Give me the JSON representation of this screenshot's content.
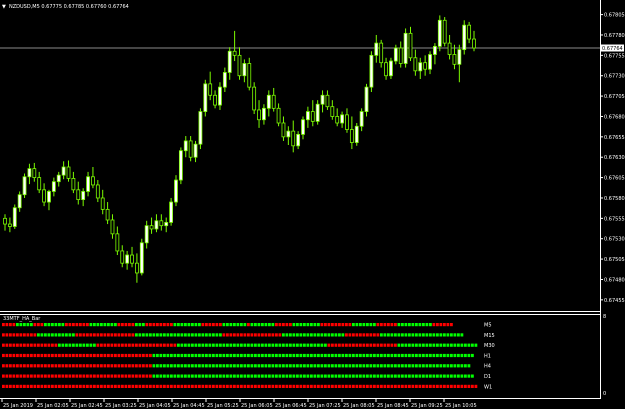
{
  "main_chart": {
    "symbol_header": "NZDUSD,M5  0.67775 0.67785 0.67760 0.67764",
    "price_labels": [
      "0.67805",
      "0.67780",
      "0.67755",
      "0.67730",
      "0.67705",
      "0.67680",
      "0.67655",
      "0.67630",
      "0.67605",
      "0.67580",
      "0.67555",
      "0.67530",
      "0.67505",
      "0.67480",
      "0.67455"
    ],
    "current_price": "0.67764",
    "current_price_value": 0.67764,
    "y_range": [
      0.67445,
      0.67818
    ],
    "candle_color": "#7cfc00",
    "candles": [
      [
        0.67555,
        0.6756,
        0.6754,
        0.67548
      ],
      [
        0.67548,
        0.67556,
        0.67538,
        0.67545
      ],
      [
        0.67545,
        0.67572,
        0.67542,
        0.67568
      ],
      [
        0.67568,
        0.67588,
        0.67563,
        0.67584
      ],
      [
        0.67584,
        0.6761,
        0.6758,
        0.67606
      ],
      [
        0.67606,
        0.67622,
        0.67597,
        0.67616
      ],
      [
        0.67616,
        0.67623,
        0.676,
        0.67605
      ],
      [
        0.67605,
        0.67612,
        0.67586,
        0.6759
      ],
      [
        0.6759,
        0.67598,
        0.6757,
        0.67575
      ],
      [
        0.67575,
        0.6759,
        0.67565,
        0.67588
      ],
      [
        0.67588,
        0.67605,
        0.67582,
        0.676
      ],
      [
        0.676,
        0.67612,
        0.67594,
        0.67608
      ],
      [
        0.67608,
        0.67625,
        0.67603,
        0.67618
      ],
      [
        0.67618,
        0.67626,
        0.676,
        0.67604
      ],
      [
        0.67604,
        0.67612,
        0.67586,
        0.6759
      ],
      [
        0.6759,
        0.676,
        0.67572,
        0.67578
      ],
      [
        0.67578,
        0.67592,
        0.6757,
        0.67588
      ],
      [
        0.67588,
        0.67612,
        0.67582,
        0.67606
      ],
      [
        0.67606,
        0.67618,
        0.67592,
        0.67596
      ],
      [
        0.67596,
        0.67602,
        0.67575,
        0.6758
      ],
      [
        0.6758,
        0.6759,
        0.6756,
        0.67566
      ],
      [
        0.67566,
        0.67575,
        0.67548,
        0.67553
      ],
      [
        0.67553,
        0.6756,
        0.6753,
        0.67536
      ],
      [
        0.67536,
        0.67545,
        0.6751,
        0.67515
      ],
      [
        0.67515,
        0.67522,
        0.67495,
        0.675
      ],
      [
        0.675,
        0.67515,
        0.67492,
        0.6751
      ],
      [
        0.6751,
        0.6752,
        0.67495,
        0.675
      ],
      [
        0.675,
        0.67512,
        0.67476,
        0.67488
      ],
      [
        0.67488,
        0.6753,
        0.67485,
        0.67525
      ],
      [
        0.67525,
        0.67552,
        0.67518,
        0.67546
      ],
      [
        0.67546,
        0.67556,
        0.67536,
        0.67542
      ],
      [
        0.67542,
        0.6756,
        0.67538,
        0.67552
      ],
      [
        0.67552,
        0.6756,
        0.6754,
        0.67546
      ],
      [
        0.67546,
        0.67556,
        0.67538,
        0.6755
      ],
      [
        0.6755,
        0.6758,
        0.67546,
        0.67575
      ],
      [
        0.67575,
        0.67608,
        0.6757,
        0.67602
      ],
      [
        0.67602,
        0.67642,
        0.67597,
        0.67638
      ],
      [
        0.67638,
        0.67656,
        0.6763,
        0.6765
      ],
      [
        0.6765,
        0.67656,
        0.67625,
        0.6763
      ],
      [
        0.6763,
        0.6765,
        0.67624,
        0.67646
      ],
      [
        0.67646,
        0.6769,
        0.6764,
        0.67686
      ],
      [
        0.67686,
        0.67725,
        0.6768,
        0.6772
      ],
      [
        0.6772,
        0.67735,
        0.677,
        0.67706
      ],
      [
        0.67706,
        0.67712,
        0.6769,
        0.67694
      ],
      [
        0.67694,
        0.67722,
        0.67688,
        0.67716
      ],
      [
        0.67716,
        0.6774,
        0.6771,
        0.67734
      ],
      [
        0.67734,
        0.67765,
        0.67725,
        0.6776
      ],
      [
        0.6776,
        0.67785,
        0.67748,
        0.67755
      ],
      [
        0.67755,
        0.67765,
        0.67725,
        0.6773
      ],
      [
        0.6773,
        0.6775,
        0.67722,
        0.67745
      ],
      [
        0.67745,
        0.67752,
        0.67712,
        0.67716
      ],
      [
        0.67716,
        0.67722,
        0.67683,
        0.67688
      ],
      [
        0.67688,
        0.677,
        0.67666,
        0.67676
      ],
      [
        0.67676,
        0.67695,
        0.6767,
        0.6769
      ],
      [
        0.6769,
        0.67712,
        0.6768,
        0.67706
      ],
      [
        0.67706,
        0.67715,
        0.67686,
        0.6769
      ],
      [
        0.6769,
        0.67696,
        0.67668,
        0.67672
      ],
      [
        0.67672,
        0.6768,
        0.6765,
        0.67655
      ],
      [
        0.67655,
        0.67668,
        0.67645,
        0.67662
      ],
      [
        0.67662,
        0.67675,
        0.67636,
        0.67644
      ],
      [
        0.67644,
        0.67662,
        0.6764,
        0.67658
      ],
      [
        0.67658,
        0.6768,
        0.67652,
        0.67676
      ],
      [
        0.67676,
        0.67692,
        0.67666,
        0.67686
      ],
      [
        0.67686,
        0.677,
        0.67668,
        0.67674
      ],
      [
        0.67674,
        0.677,
        0.6767,
        0.67695
      ],
      [
        0.67695,
        0.67712,
        0.67685,
        0.67706
      ],
      [
        0.67706,
        0.67712,
        0.67688,
        0.67692
      ],
      [
        0.67692,
        0.677,
        0.67676,
        0.6768
      ],
      [
        0.6768,
        0.6769,
        0.67668,
        0.67672
      ],
      [
        0.67672,
        0.67686,
        0.67666,
        0.67682
      ],
      [
        0.67682,
        0.6769,
        0.6766,
        0.67664
      ],
      [
        0.67664,
        0.6768,
        0.6764,
        0.67648
      ],
      [
        0.67648,
        0.67672,
        0.67644,
        0.67668
      ],
      [
        0.67668,
        0.6769,
        0.67662,
        0.67686
      ],
      [
        0.67686,
        0.6772,
        0.6768,
        0.67716
      ],
      [
        0.67716,
        0.6776,
        0.6771,
        0.67755
      ],
      [
        0.67755,
        0.6778,
        0.67746,
        0.6777
      ],
      [
        0.6777,
        0.67774,
        0.6774,
        0.67746
      ],
      [
        0.67746,
        0.67752,
        0.67725,
        0.6773
      ],
      [
        0.6773,
        0.67752,
        0.67726,
        0.67748
      ],
      [
        0.67748,
        0.67768,
        0.67744,
        0.67764
      ],
      [
        0.67764,
        0.67772,
        0.6774,
        0.67745
      ],
      [
        0.67745,
        0.67788,
        0.6774,
        0.67782
      ],
      [
        0.67782,
        0.6779,
        0.67748,
        0.67752
      ],
      [
        0.67752,
        0.67762,
        0.6773,
        0.67736
      ],
      [
        0.67736,
        0.67752,
        0.67726,
        0.67746
      ],
      [
        0.67746,
        0.67755,
        0.6773,
        0.67738
      ],
      [
        0.67738,
        0.6776,
        0.67732,
        0.67756
      ],
      [
        0.67756,
        0.6777,
        0.67744,
        0.67766
      ],
      [
        0.67766,
        0.67804,
        0.6776,
        0.67798
      ],
      [
        0.67798,
        0.67802,
        0.67766,
        0.6777
      ],
      [
        0.6777,
        0.6778,
        0.6775,
        0.67756
      ],
      [
        0.67756,
        0.67768,
        0.67738,
        0.67744
      ],
      [
        0.67744,
        0.67768,
        0.67722,
        0.67762
      ],
      [
        0.67762,
        0.67798,
        0.67756,
        0.67792
      ],
      [
        0.67792,
        0.67796,
        0.6777,
        0.67775
      ],
      [
        0.67775,
        0.67785,
        0.6776,
        0.67764
      ]
    ],
    "time_labels": [
      "25 Jan 2019",
      "25 Jan 02:05",
      "25 Jan 02:45",
      "25 Jan 03:25",
      "25 Jan 04:05",
      "25 Jan 04:45",
      "25 Jan 05:25",
      "25 Jan 06:05",
      "25 Jan 06:45",
      "25 Jan 07:25",
      "25 Jan 08:05",
      "25 Jan 08:45",
      "25 Jan 09:25",
      "25 Jan 10:05"
    ]
  },
  "indicator": {
    "title": "33MTF_HA_Bar",
    "scale_labels": [
      "8",
      "0"
    ],
    "up_color": "#00ff00",
    "down_color": "#ff0000",
    "rows": [
      {
        "label": "M5",
        "pattern": "RRRRGGGGGRRRGGGGGGRRRRRRRGGGGGGGGRRRRRGGGRRRRRRRRGGGGGGGGRRRRRRGGGGGGGRGGGGGGGRRRRRGGGGGGGGRRRRRRRRRGGGGGGGRRRRRRGGGGGGGGGGRRRRRR"
      },
      {
        "label": "M15",
        "pattern": "RRRRRRRRRRGGGGGGGGGGGRRRRRRRRRRRRRRRRRGGGGGGGGGGGGGGGGGGGGGGGGGRRRRRRRRRRRRRRRRRGGGGGGGGGGGGGGGGGGRRRRRRRRRRGGGGGGGGGGGGGGGGGGGGGGGG"
      },
      {
        "label": "M30",
        "pattern": "RRRRRRRRRRRRRRRRGGGGGGGGGGGRRRRRRRRRRRRRRRRRRRRRRRGGGGGGGGGGGGGGGGGGGGGGGGGGGGGGGGGGGGGGGGGGGRRRRRRRRRRRRRRRRRRRRGGGGGGGGGGGGGGGGGGGGGGG"
      },
      {
        "label": "H1",
        "pattern": "RRRRRRRRRRRRRRRRRRRRRRRRRRRRRRRRRRRRRRRRRRRGGGGGGGGGGGGGGGGGGGGGGGGGGGGGGGGGGGGGGGGGGGGGGGGGGGGGGGGGGGGGGGGGGGGGGGGGGGGGGGGGGGGGGGGGGGG"
      },
      {
        "label": "H4",
        "pattern": "RRRRRRRRRRRRRRRRRRRRRRRRRRRRRRRRRRRRRRRRRRRGGGGGGGGGGGGGGGGGGGGGGGGGGGGGGGGGGGGGGGGGGGGGGGGGGGGGGGGGGGGGGGGGGGGGGGGGGGGGGGGGGGGGGGGGGG"
      },
      {
        "label": "D1",
        "pattern": "RRRRRRRRRRRRRRRRRRRRRRRRRRRRRRRRRRRRRRRRRRRGGGGGGGGGGGGGGGGGGGGGGGGGGGGGGGGGGGGGGGGGGGGGGGGGGGGGGGGGGGGGGGGGGGGGGGGGGGGGGGGGGGGGGGGGGGG"
      },
      {
        "label": "W1",
        "pattern": "RRRRRRRRRRRRRRRRRRRRRRRRRRRRRRRRRRRRRRRRRRRRRRRRRRRRRRRRRRRRRRRRRRRRRRRRRRRRRRRRRRRRRRRRRRRRRRRRRRRRRRRRRRRRRRRRRRRRRRRRRRRRRRRRRRRRRRRRRRRR"
      }
    ]
  }
}
